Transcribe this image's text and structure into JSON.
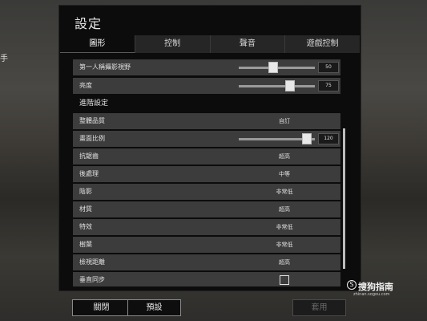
{
  "window": {
    "title": "設定"
  },
  "background": {
    "left_fragment": "手"
  },
  "tabs": [
    {
      "label": "圖形",
      "active": true
    },
    {
      "label": "控制",
      "active": false
    },
    {
      "label": "聲音",
      "active": false
    },
    {
      "label": "遊戲控制",
      "active": false
    }
  ],
  "basic_settings": [
    {
      "label": "第一人稱攝影視野",
      "type": "slider",
      "value": "50",
      "fraction": 0.45
    },
    {
      "label": "亮度",
      "type": "slider",
      "value": "75",
      "fraction": 0.7
    }
  ],
  "advanced_header": "進階設定",
  "advanced_settings": [
    {
      "label": "整體品質",
      "type": "dropdown",
      "value": "自訂"
    },
    {
      "label": "畫面比例",
      "type": "slider",
      "value": "120",
      "fraction": 0.95
    },
    {
      "label": "抗鋸齒",
      "type": "dropdown",
      "value": "超高"
    },
    {
      "label": "後處理",
      "type": "dropdown",
      "value": "中等"
    },
    {
      "label": "陰影",
      "type": "dropdown",
      "value": "非常低"
    },
    {
      "label": "材質",
      "type": "dropdown",
      "value": "超高"
    },
    {
      "label": "特效",
      "type": "dropdown",
      "value": "非常低"
    },
    {
      "label": "樹葉",
      "type": "dropdown",
      "value": "非常低"
    },
    {
      "label": "檢視距離",
      "type": "dropdown",
      "value": "超高"
    },
    {
      "label": "垂直同步",
      "type": "checkbox",
      "checked": false
    }
  ],
  "buttons": {
    "close": "關閉",
    "default": "預設",
    "apply": "套用"
  },
  "watermark": {
    "icon": "S",
    "text": "搜狗指南",
    "sub": "zhinan.sogou.com"
  }
}
